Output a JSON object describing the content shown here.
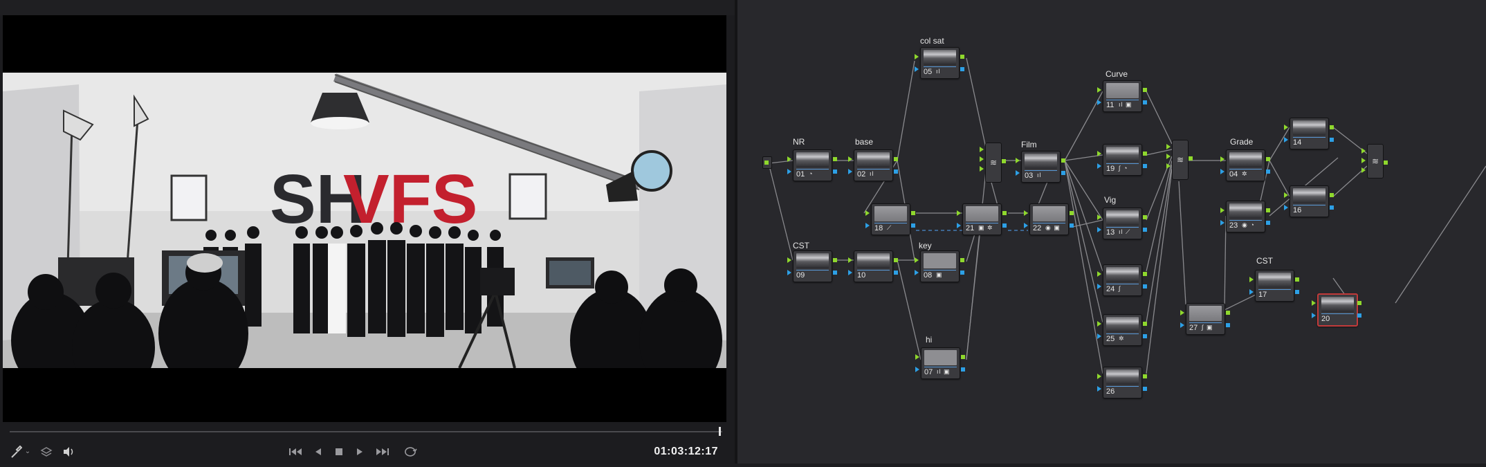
{
  "viewer": {
    "timecode": "01:03:12:17",
    "video": {
      "banner": "SHVFS",
      "banner_colors": {
        "sh": "#2a2a2e",
        "vfs": "#c3202e"
      },
      "background_color": "#dedede"
    },
    "controls": {
      "picker_icon": "eyedropper-icon",
      "picker_dropdown_icon": "chevron-down-icon",
      "layers_icon": "layers-icon",
      "audio_icon": "speaker-icon",
      "first_icon": "skip-to-start-icon",
      "reverse_icon": "play-reverse-icon",
      "stop_icon": "stop-icon",
      "play_icon": "play-icon",
      "last_icon": "skip-to-end-icon",
      "loop_icon": "loop-icon"
    },
    "playhead_fraction": 0.995
  },
  "node_editor": {
    "selected_node": "20",
    "labels": {
      "col_sat": "col sat",
      "nr": "NR",
      "base": "base",
      "film": "Film",
      "curve": "Curve",
      "grade": "Grade",
      "cst1": "CST",
      "key": "key",
      "vig": "Vig",
      "hi": "hi",
      "cst2": "CST"
    },
    "nodes": {
      "n01": {
        "num": "01",
        "icons": "◔"
      },
      "n02": {
        "num": "02",
        "icons": "ıl"
      },
      "n03": {
        "num": "03",
        "icons": "ıl"
      },
      "n04": {
        "num": "04",
        "icons": "✲"
      },
      "n05": {
        "num": "05",
        "icons": "ıl"
      },
      "n07": {
        "num": "07",
        "icons": "ıl ▣"
      },
      "n08": {
        "num": "08",
        "icons": "▣"
      },
      "n09": {
        "num": "09",
        "icons": ""
      },
      "n10": {
        "num": "10",
        "icons": ""
      },
      "n11": {
        "num": "11",
        "icons": "ıl ▣"
      },
      "n13": {
        "num": "13",
        "icons": "ıl ⟋"
      },
      "n14": {
        "num": "14",
        "icons": ""
      },
      "n16": {
        "num": "16",
        "icons": ""
      },
      "n17": {
        "num": "17",
        "icons": ""
      },
      "n18": {
        "num": "18",
        "icons": "⟋"
      },
      "n19": {
        "num": "19",
        "icons": "∫ ◔"
      },
      "n20": {
        "num": "20",
        "icons": ""
      },
      "n21": {
        "num": "21",
        "icons": "▣ ✲"
      },
      "n22": {
        "num": "22",
        "icons": "◉ ▣"
      },
      "n23": {
        "num": "23",
        "icons": "◉ ◔"
      },
      "n24": {
        "num": "24",
        "icons": "∫"
      },
      "n25": {
        "num": "25",
        "icons": "✲"
      },
      "n26": {
        "num": "26",
        "icons": ""
      },
      "n27": {
        "num": "27",
        "icons": "∫ ▣"
      }
    },
    "mixer_glyph": "≋"
  }
}
